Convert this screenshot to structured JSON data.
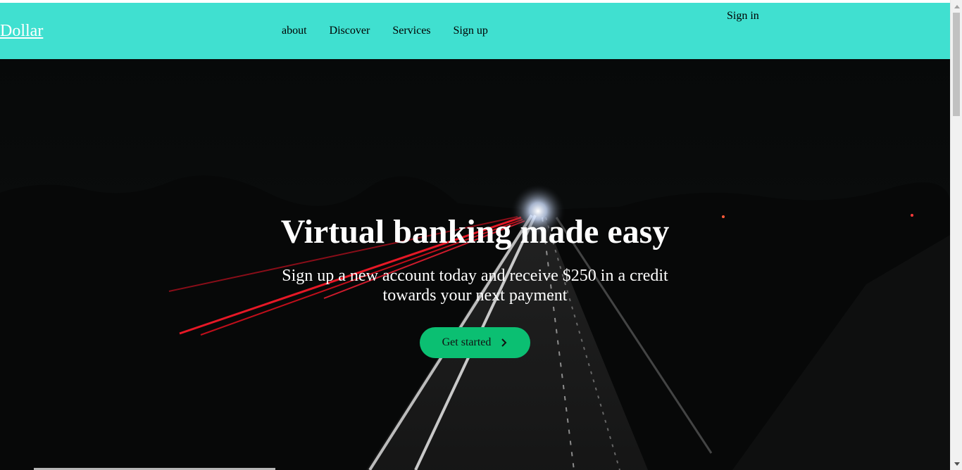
{
  "navbar": {
    "logo": "Dollar",
    "links": [
      "about",
      "Discover",
      "Services",
      "Sign up"
    ],
    "signin": "Sign in",
    "background": "#40e0d0"
  },
  "hero": {
    "title": "Virtual banking made easy",
    "subtitle": "Sign up a new account today and receive $250 in a credit towards your next payment",
    "cta_label": "Get started",
    "cta_icon": "chevron-right-icon",
    "cta_color": "#0bbf72",
    "background_image": "night highway with light trails"
  }
}
